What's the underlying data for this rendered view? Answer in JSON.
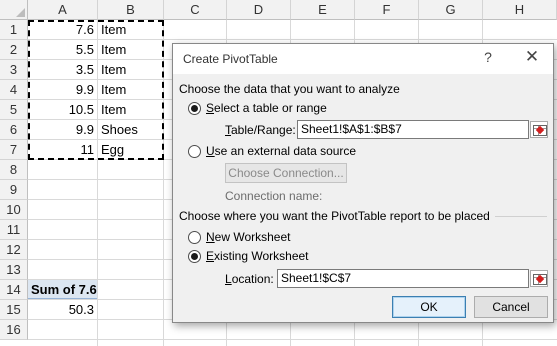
{
  "columns": [
    "A",
    "B",
    "C",
    "D",
    "E",
    "F",
    "G",
    "H"
  ],
  "rows": [
    "1",
    "2",
    "3",
    "4",
    "5",
    "6",
    "7",
    "8",
    "9",
    "10",
    "11",
    "12",
    "13",
    "14",
    "15",
    "16"
  ],
  "data": [
    {
      "a": "7.6",
      "b": "Item"
    },
    {
      "a": "5.5",
      "b": "Item"
    },
    {
      "a": "3.5",
      "b": "Item"
    },
    {
      "a": "9.9",
      "b": "Item"
    },
    {
      "a": "10.5",
      "b": "Item"
    },
    {
      "a": "9.9",
      "b": "Shoes"
    },
    {
      "a": "11",
      "b": "Egg"
    }
  ],
  "pivot": {
    "header": "Sum of 7.6",
    "value": "50.3"
  },
  "dialog": {
    "title": "Create PivotTable",
    "help": "?",
    "close": "✕",
    "section1": "Choose the data that you want to analyze",
    "opt_table": "elect a table or range",
    "opt_table_key": "S",
    "table_range_label": "able/Range:",
    "table_range_key": "T",
    "table_range_value": "Sheet1!$A$1:$B$7",
    "opt_external": "se an external data source",
    "opt_external_key": "U",
    "choose_connection": "Choose Connection...",
    "connection_name": "Connection name:",
    "section2": "Choose where you want the PivotTable report to be placed",
    "opt_new": "ew Worksheet",
    "opt_new_key": "N",
    "opt_existing": "xisting Worksheet",
    "opt_existing_key": "E",
    "location_label": "ocation:",
    "location_key": "L",
    "location_value": "Sheet1!$C$7",
    "ok": "OK",
    "cancel": "Cancel"
  }
}
